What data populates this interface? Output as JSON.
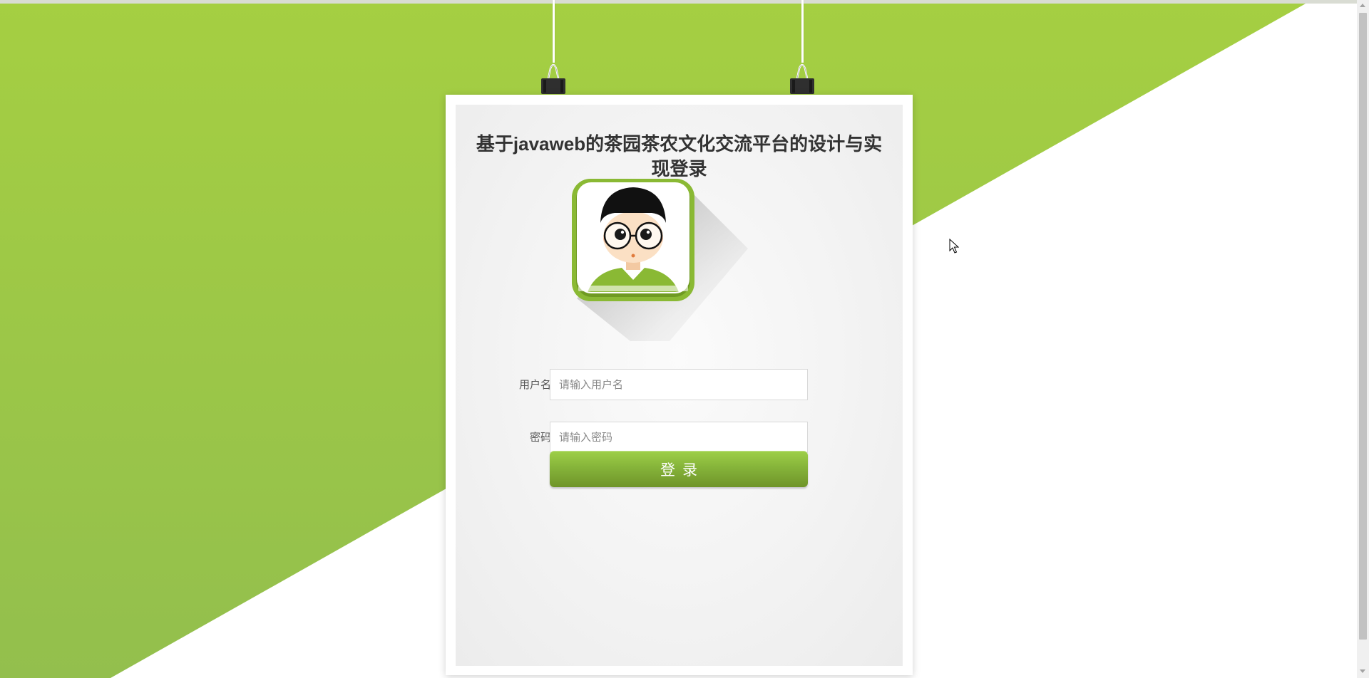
{
  "page": {
    "title": "基于javaweb的茶园茶农文化交流平台的设计与实现登录"
  },
  "form": {
    "username_label": "用户名:",
    "username_placeholder": "请输入用户名",
    "password_label": "密码:",
    "password_placeholder": "请输入密码",
    "login_button": "登录"
  },
  "colors": {
    "brand_green": "#a5cf42",
    "button_green": "#86b43a"
  },
  "icons": {
    "avatar": "avatar-icon",
    "clip": "binder-clip-icon",
    "cursor": "mouse-cursor-icon"
  }
}
